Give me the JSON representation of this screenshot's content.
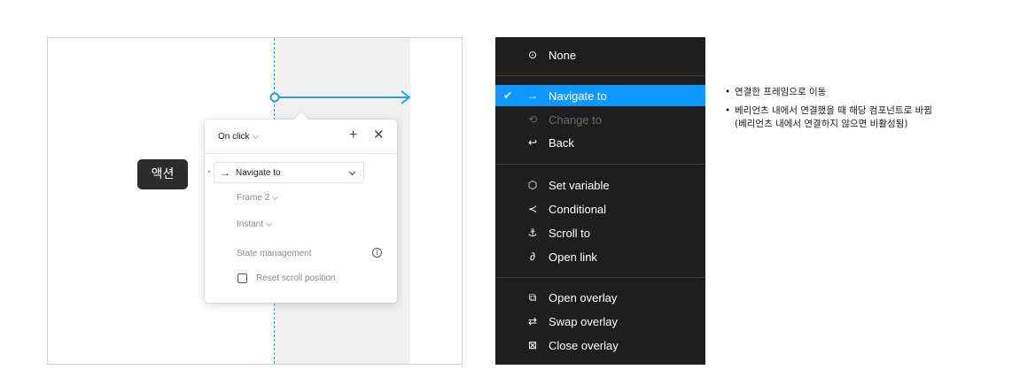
{
  "canvas": {
    "action_tag": "액션",
    "panel": {
      "trigger": "On click",
      "action": "Navigate to",
      "destination": "Frame 2",
      "animation": "Instant",
      "state_management": "State management",
      "reset_scroll": "Reset scroll position",
      "reset_scroll_checked": false
    }
  },
  "menu": {
    "items": [
      {
        "label": "None",
        "icon": "circle-dot-icon",
        "selected": false,
        "disabled": false
      },
      {
        "label": "Navigate to",
        "icon": "arrow-right-icon",
        "selected": true,
        "disabled": false
      },
      {
        "label": "Change to",
        "icon": "swap-cycle-icon",
        "selected": false,
        "disabled": true
      },
      {
        "label": "Back",
        "icon": "arrow-left-icon",
        "selected": false,
        "disabled": false
      },
      {
        "label": "Set variable",
        "icon": "hexagon-dot-icon",
        "selected": false,
        "disabled": false
      },
      {
        "label": "Conditional",
        "icon": "branch-icon",
        "selected": false,
        "disabled": false
      },
      {
        "label": "Scroll to",
        "icon": "anchor-icon",
        "selected": false,
        "disabled": false
      },
      {
        "label": "Open link",
        "icon": "link-icon",
        "selected": false,
        "disabled": false
      },
      {
        "label": "Open overlay",
        "icon": "open-overlay-icon",
        "selected": false,
        "disabled": false
      },
      {
        "label": "Swap overlay",
        "icon": "swap-overlay-icon",
        "selected": false,
        "disabled": false
      },
      {
        "label": "Close overlay",
        "icon": "close-overlay-icon",
        "selected": false,
        "disabled": false
      }
    ]
  },
  "notes": [
    "연결한 프레임으로 이동",
    "베리언츠 내에서 연결했을 때 해당 컴포넌트로 바뀜",
    "(베리언츠 내에서 연결하지 않으면 비활성됨)"
  ],
  "colors": {
    "accent": "#0d99ff",
    "connector": "#27a0ea",
    "menu_bg": "#1e1e1e",
    "tag_bg": "#2c2c2c"
  }
}
